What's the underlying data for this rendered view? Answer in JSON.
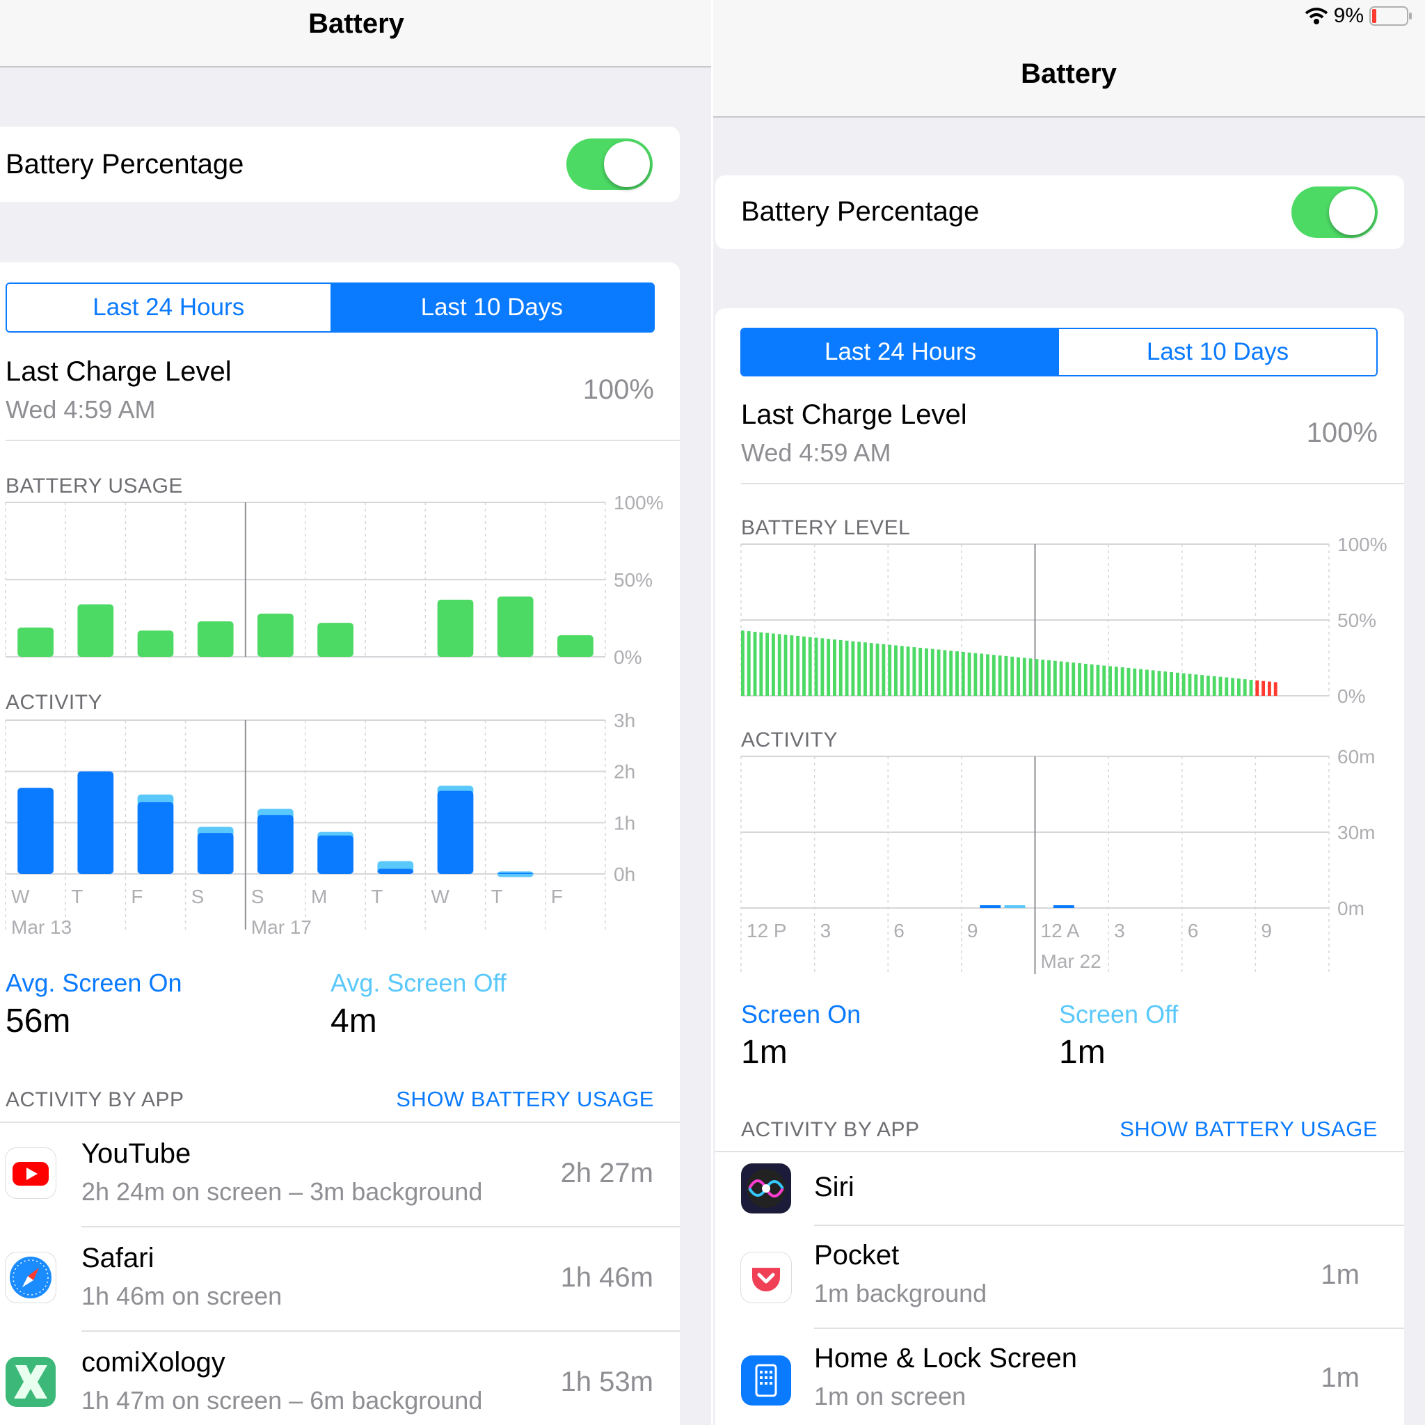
{
  "left": {
    "title": "Battery",
    "battery_percentage_label": "Battery Percentage",
    "battery_percentage_on": true,
    "segments": [
      "Last 24 Hours",
      "Last 10 Days"
    ],
    "selected_segment": 1,
    "last_charge": {
      "label": "Last Charge Level",
      "time": "Wed 4:59 AM",
      "value": "100%"
    },
    "usage_header": "BATTERY USAGE",
    "activity_header": "ACTIVITY",
    "stats": {
      "on_label": "Avg. Screen On",
      "on_value": "56m",
      "off_label": "Avg. Screen Off",
      "off_value": "4m"
    },
    "activity_by_app": "ACTIVITY BY APP",
    "show_usage": "SHOW BATTERY USAGE",
    "apps": [
      {
        "name": "YouTube",
        "detail": "2h 24m on screen – 3m background",
        "time": "2h 27m",
        "icon": "youtube-icon"
      },
      {
        "name": "Safari",
        "detail": "1h 46m on screen",
        "time": "1h 46m",
        "icon": "safari-icon"
      },
      {
        "name": "comiXology",
        "detail": "1h 47m on screen – 6m background",
        "time": "1h 53m",
        "icon": "comixology-icon"
      }
    ]
  },
  "right": {
    "status": {
      "percent": "9%"
    },
    "title": "Battery",
    "battery_percentage_label": "Battery Percentage",
    "battery_percentage_on": true,
    "segments": [
      "Last 24 Hours",
      "Last 10 Days"
    ],
    "selected_segment": 0,
    "last_charge": {
      "label": "Last Charge Level",
      "time": "Wed 4:59 AM",
      "value": "100%"
    },
    "level_header": "BATTERY LEVEL",
    "activity_header": "ACTIVITY",
    "stats": {
      "on_label": "Screen On",
      "on_value": "1m",
      "off_label": "Screen Off",
      "off_value": "1m"
    },
    "activity_by_app": "ACTIVITY BY APP",
    "show_usage": "SHOW BATTERY USAGE",
    "apps": [
      {
        "name": "Siri",
        "detail": "",
        "time": "",
        "icon": "siri-icon"
      },
      {
        "name": "Pocket",
        "detail": "1m background",
        "time": "1m",
        "icon": "pocket-icon"
      },
      {
        "name": "Home & Lock Screen",
        "detail": "1m on screen",
        "time": "1m",
        "icon": "home-lock-icon"
      }
    ]
  },
  "chart_data": [
    {
      "type": "bar",
      "title": "BATTERY USAGE",
      "categories": [
        "W",
        "T",
        "F",
        "S",
        "S",
        "M",
        "T",
        "W",
        "T",
        "F"
      ],
      "date_labels": [
        "Mar 13",
        "Mar 17"
      ],
      "values": [
        19,
        34,
        17,
        23,
        28,
        22,
        0,
        37,
        39,
        14
      ],
      "y_ticks": [
        "100%",
        "50%",
        "0%"
      ],
      "ylim": [
        0,
        100
      ],
      "color": "#4cd964"
    },
    {
      "type": "bar",
      "title": "ACTIVITY",
      "categories": [
        "W",
        "T",
        "F",
        "S",
        "S",
        "M",
        "T",
        "W",
        "T",
        "F"
      ],
      "date_labels": [
        "Mar 13",
        "Mar 17"
      ],
      "series": [
        {
          "values": [
            1.68,
            2.0,
            1.4,
            0.8,
            1.15,
            0.75,
            0.1,
            1.62,
            0.02,
            0
          ]
        },
        {
          "values": [
            0,
            0,
            0.15,
            0.12,
            0.12,
            0.07,
            0.15,
            0.1,
            0.03,
            0
          ]
        }
      ],
      "y_ticks": [
        "3h",
        "2h",
        "1h",
        "0h"
      ],
      "ylim": [
        0,
        3
      ],
      "colors": [
        "#0a7aff",
        "#5ac8fa"
      ]
    },
    {
      "type": "bar",
      "title": "BATTERY LEVEL",
      "x_ticks": [
        "12 P",
        "3",
        "6",
        "9",
        "12 A",
        "3",
        "6",
        "9"
      ],
      "date_labels": [
        "Mar 22"
      ],
      "values_start": 43,
      "values_end": 9,
      "low_threshold": 10,
      "y_ticks": [
        "100%",
        "50%",
        "0%"
      ],
      "ylim": [
        0,
        100
      ],
      "colors": [
        "#4cd964",
        "#ff3b30"
      ]
    },
    {
      "type": "bar",
      "title": "ACTIVITY",
      "x_ticks": [
        "12 P",
        "3",
        "6",
        "9",
        "12 A",
        "3",
        "6",
        "9"
      ],
      "date_labels": [
        "Mar 22"
      ],
      "bars": [
        {
          "x": 9.75,
          "minutes": 1,
          "color": "#0a7aff"
        },
        {
          "x": 10.75,
          "minutes": 1,
          "color": "#5ac8fa"
        },
        {
          "x": 12.75,
          "minutes": 1,
          "color": "#0a7aff"
        }
      ],
      "y_ticks": [
        "60m",
        "30m",
        "0m"
      ],
      "ylim": [
        0,
        60
      ]
    }
  ]
}
